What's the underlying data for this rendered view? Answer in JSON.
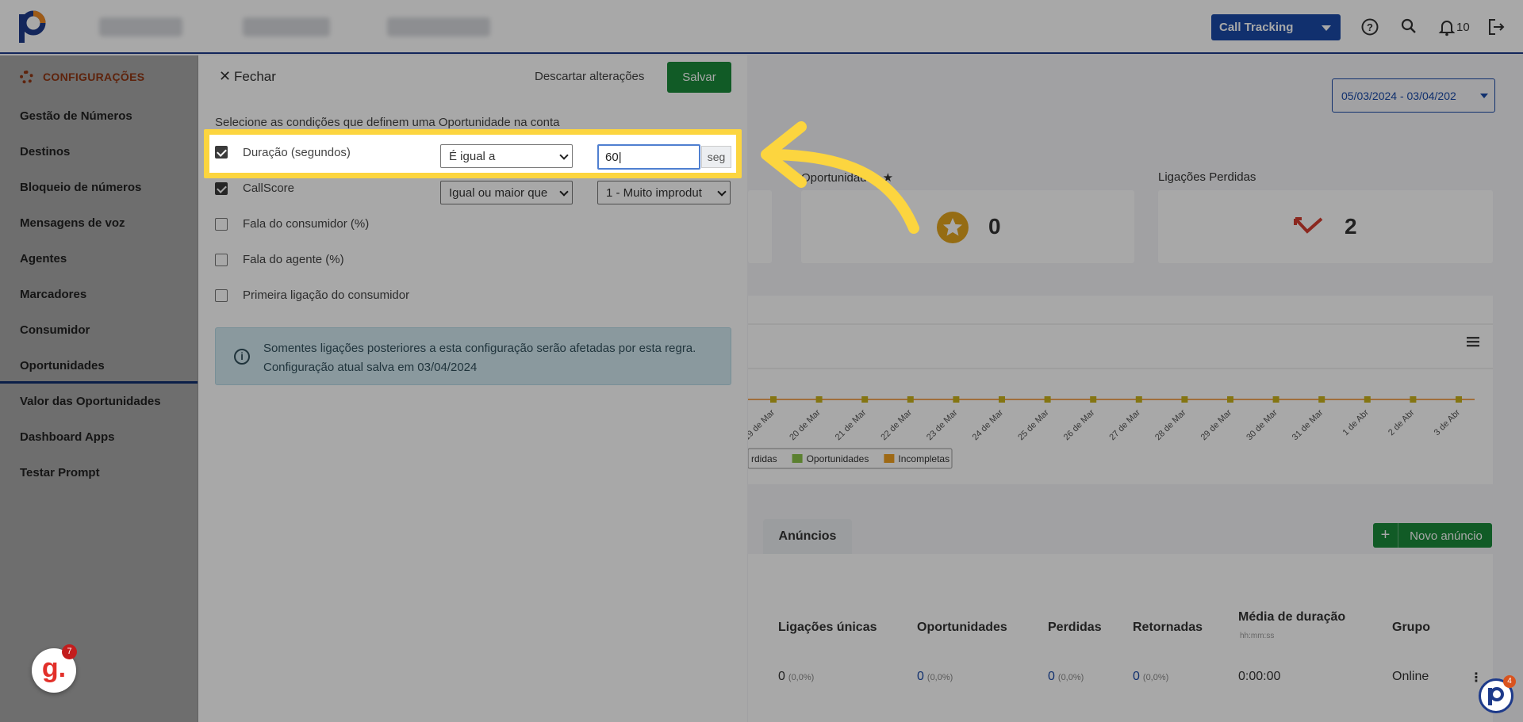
{
  "topbar": {
    "product_select": "Call Tracking",
    "notifications_count": "10"
  },
  "sidebar": {
    "header": "CONFIGURAÇÕES",
    "items": [
      {
        "label": "Gestão de Números"
      },
      {
        "label": "Destinos"
      },
      {
        "label": "Bloqueio de números"
      },
      {
        "label": "Mensagens de voz"
      },
      {
        "label": "Agentes"
      },
      {
        "label": "Marcadores"
      },
      {
        "label": "Consumidor"
      },
      {
        "label": "Oportunidades",
        "active": true
      },
      {
        "label": "Valor das Oportunidades"
      },
      {
        "label": "Dashboard Apps"
      },
      {
        "label": "Testar Prompt"
      }
    ]
  },
  "dashboard": {
    "date_range": "05/03/2024 - 03/04/202",
    "kpis": [
      {
        "label": "Oportunidades ★",
        "value": "0"
      },
      {
        "label": "Ligações Perdidas",
        "value": "2"
      }
    ],
    "chart": {
      "x_labels": [
        "19 de Mar",
        "20 de Mar",
        "21 de Mar",
        "22 de Mar",
        "23 de Mar",
        "24 de Mar",
        "25 de Mar",
        "26 de Mar",
        "27 de Mar",
        "28 de Mar",
        "29 de Mar",
        "30 de Mar",
        "31 de Mar",
        "1 de Abr",
        "2 de Abr",
        "3 de Abr"
      ],
      "legend": [
        {
          "name": "rdidas",
          "color": "#f08a24"
        },
        {
          "name": "Oportunidades",
          "color": "#8bc34a"
        },
        {
          "name": "Incompletas",
          "color": "#f0a020"
        }
      ]
    },
    "tab_label": "Anúncios",
    "new_ad_button": "Novo anúncio",
    "table": {
      "headers": [
        "Ligações únicas",
        "Oportunidades",
        "Perdidas",
        "Retornadas",
        "Média de duração",
        "Grupo"
      ],
      "duration_sub": "hh:mm:ss",
      "row": {
        "unicas": "0",
        "unicas_pct": "(0,0%)",
        "oportunidades": "0",
        "oportunidades_pct": "(0,0%)",
        "perdidas": "0",
        "perdidas_pct": "(0,0%)",
        "retornadas": "0",
        "retornadas_pct": "(0,0%)",
        "duracao": "0:00:00",
        "grupo": "Online"
      }
    }
  },
  "panel": {
    "close_label": "Fechar",
    "discard_label": "Descartar alterações",
    "save_label": "Salvar",
    "intro": "Selecione as condições que definem uma Oportunidade na conta",
    "conditions": [
      {
        "label": "Duração (segundos)",
        "checked": true,
        "operator": "É igual a",
        "value": "60",
        "unit": "seg"
      },
      {
        "label": "CallScore",
        "checked": true,
        "operator": "Igual ou maior que",
        "value": "1 - Muito improdut"
      },
      {
        "label": "Fala do consumidor (%)",
        "checked": false
      },
      {
        "label": "Fala do agente (%)",
        "checked": false
      },
      {
        "label": "Primeira ligação do consumidor",
        "checked": false
      }
    ],
    "info_line1": "Somentes ligações posteriores a esta configuração serão afetadas por esta regra.",
    "info_line2": "Configuração atual salva em 03/04/2024"
  },
  "badges": {
    "g_letter": "g.",
    "g_count": "7",
    "p_count": "4"
  },
  "colors": {
    "brand_blue": "#1a4aa8",
    "save_green": "#1b8a3b",
    "accent_orange": "#d9531e",
    "highlight_yellow": "#fcd53f"
  }
}
